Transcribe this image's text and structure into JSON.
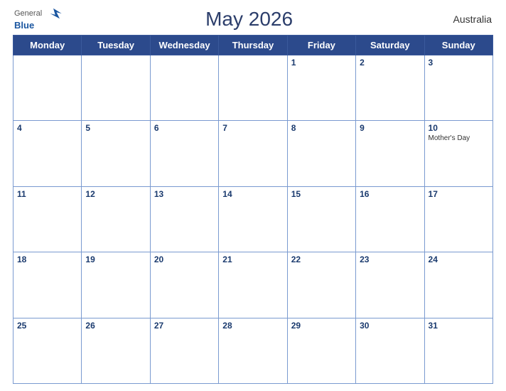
{
  "header": {
    "logo_general": "General",
    "logo_blue": "Blue",
    "title": "May 2026",
    "country": "Australia"
  },
  "weekdays": [
    "Monday",
    "Tuesday",
    "Wednesday",
    "Thursday",
    "Friday",
    "Saturday",
    "Sunday"
  ],
  "weeks": [
    [
      {
        "day": "",
        "event": ""
      },
      {
        "day": "",
        "event": ""
      },
      {
        "day": "",
        "event": ""
      },
      {
        "day": "",
        "event": ""
      },
      {
        "day": "1",
        "event": ""
      },
      {
        "day": "2",
        "event": ""
      },
      {
        "day": "3",
        "event": ""
      }
    ],
    [
      {
        "day": "4",
        "event": ""
      },
      {
        "day": "5",
        "event": ""
      },
      {
        "day": "6",
        "event": ""
      },
      {
        "day": "7",
        "event": ""
      },
      {
        "day": "8",
        "event": ""
      },
      {
        "day": "9",
        "event": ""
      },
      {
        "day": "10",
        "event": "Mother's Day"
      }
    ],
    [
      {
        "day": "11",
        "event": ""
      },
      {
        "day": "12",
        "event": ""
      },
      {
        "day": "13",
        "event": ""
      },
      {
        "day": "14",
        "event": ""
      },
      {
        "day": "15",
        "event": ""
      },
      {
        "day": "16",
        "event": ""
      },
      {
        "day": "17",
        "event": ""
      }
    ],
    [
      {
        "day": "18",
        "event": ""
      },
      {
        "day": "19",
        "event": ""
      },
      {
        "day": "20",
        "event": ""
      },
      {
        "day": "21",
        "event": ""
      },
      {
        "day": "22",
        "event": ""
      },
      {
        "day": "23",
        "event": ""
      },
      {
        "day": "24",
        "event": ""
      }
    ],
    [
      {
        "day": "25",
        "event": ""
      },
      {
        "day": "26",
        "event": ""
      },
      {
        "day": "27",
        "event": ""
      },
      {
        "day": "28",
        "event": ""
      },
      {
        "day": "29",
        "event": ""
      },
      {
        "day": "30",
        "event": ""
      },
      {
        "day": "31",
        "event": ""
      }
    ]
  ],
  "colors": {
    "header_bg": "#2c4a8c",
    "header_text": "#ffffff",
    "border": "#7a9ad0",
    "title_color": "#2c3e6b",
    "day_number_color": "#1a3a6e"
  }
}
